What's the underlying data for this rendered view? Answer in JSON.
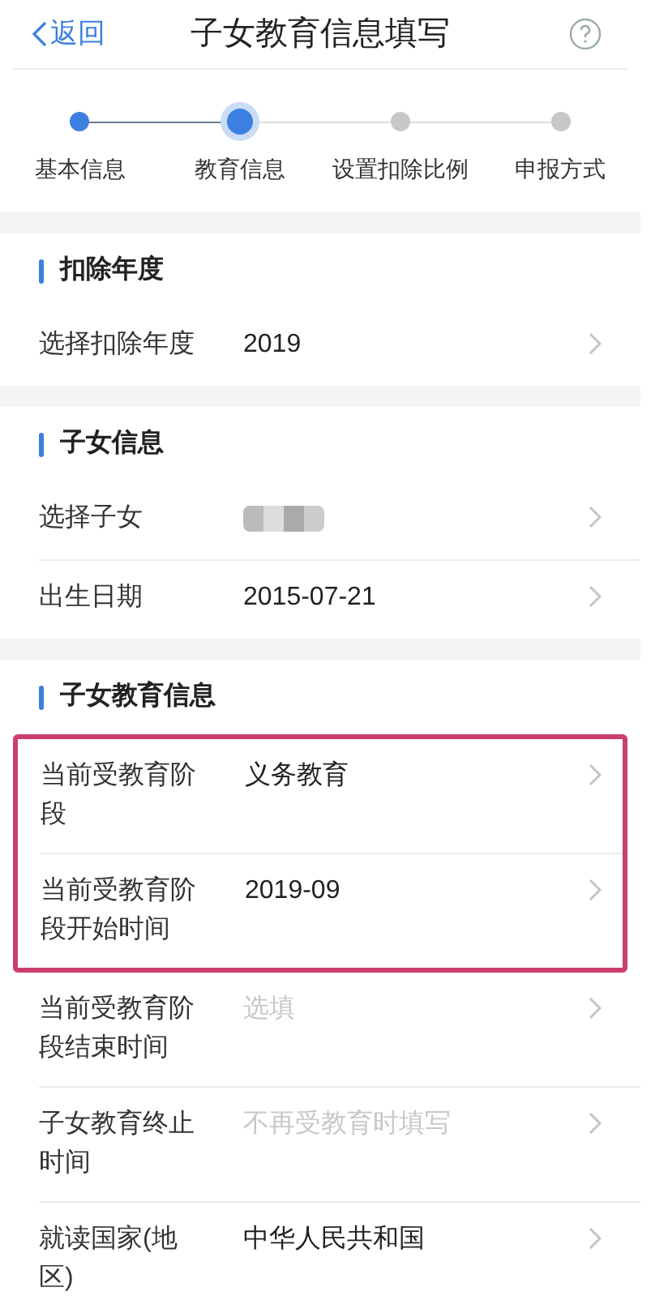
{
  "header": {
    "back": "返回",
    "title": "子女教育信息填写"
  },
  "steps": [
    {
      "label": "基本信息",
      "done": true,
      "selected": false
    },
    {
      "label": "教育信息",
      "done": true,
      "selected": true
    },
    {
      "label": "设置扣除比例",
      "done": false,
      "selected": false
    },
    {
      "label": "申报方式",
      "done": false,
      "selected": false
    }
  ],
  "sections": [
    {
      "title": "扣除年度",
      "rows": [
        {
          "label": "选择扣除年度",
          "value": "2019",
          "highlighted": false
        }
      ]
    },
    {
      "title": "子女信息",
      "rows": [
        {
          "label": "选择子女",
          "masked": true,
          "highlighted": false
        },
        {
          "label": "出生日期",
          "value": "2015-07-21",
          "highlighted": false
        }
      ]
    },
    {
      "title": "子女教育信息",
      "rows": [
        {
          "label": "当前受教育阶段",
          "value": "义务教育",
          "highlighted": true
        },
        {
          "label": "当前受教育阶段开始时间",
          "value": "2019-09",
          "highlighted": true
        },
        {
          "label": "当前受教育阶段结束时间",
          "placeholder": "选填",
          "highlighted": false
        },
        {
          "label": "子女教育终止时间",
          "placeholder": "不再受教育时填写",
          "highlighted": false
        },
        {
          "label": "就读国家(地区)",
          "value": "中华人民共和国",
          "highlighted": false
        }
      ]
    }
  ]
}
